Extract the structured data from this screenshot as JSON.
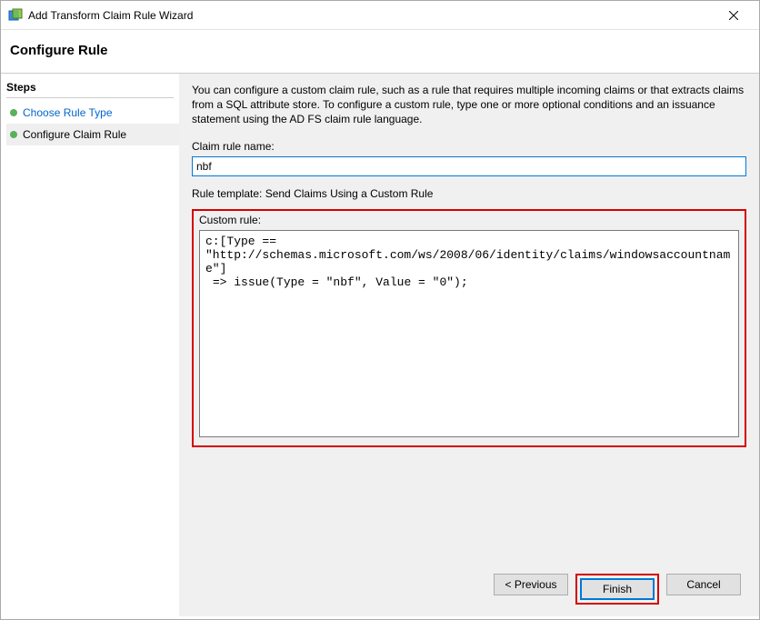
{
  "window": {
    "title": "Add Transform Claim Rule Wizard"
  },
  "header": {
    "title": "Configure Rule"
  },
  "steps": {
    "title": "Steps",
    "items": [
      {
        "label": "Choose Rule Type"
      },
      {
        "label": "Configure Claim Rule"
      }
    ]
  },
  "main": {
    "intro": "You can configure a custom claim rule, such as a rule that requires multiple incoming claims or that extracts claims from a SQL attribute store. To configure a custom rule, type one or more optional conditions and an issuance statement using the AD FS claim rule language.",
    "name_label": "Claim rule name:",
    "name_value": "nbf",
    "template_line": "Rule template: Send Claims Using a Custom Rule",
    "custom_label": "Custom rule:",
    "custom_value": "c:[Type == \"http://schemas.microsoft.com/ws/2008/06/identity/claims/windowsaccountname\"]\n => issue(Type = \"nbf\", Value = \"0\");"
  },
  "buttons": {
    "previous": "< Previous",
    "finish": "Finish",
    "cancel": "Cancel"
  }
}
